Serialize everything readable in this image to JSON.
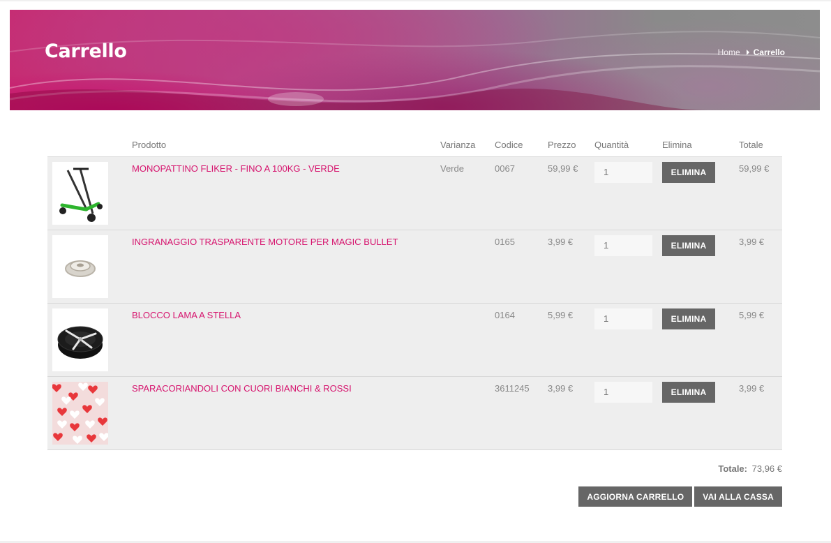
{
  "page": {
    "title": "Carrello"
  },
  "breadcrumb": {
    "home": "Home",
    "current": "Carrello"
  },
  "table": {
    "headers": {
      "product": "Prodotto",
      "variant": "Varianza",
      "code": "Codice",
      "price": "Prezzo",
      "qty": "Quantità",
      "delete": "Elimina",
      "total": "Totale"
    },
    "rows": [
      {
        "name": "MONOPATTINO FLIKER - FINO A 100KG - VERDE",
        "variant": "Verde",
        "code": "0067",
        "price": "59,99 €",
        "qty": "1",
        "delete": "ELIMINA",
        "total": "59,99 €",
        "image": "scooter-image"
      },
      {
        "name": "INGRANAGGIO TRASPARENTE MOTORE PER MAGIC BULLET",
        "variant": "",
        "code": "0165",
        "price": "3,99 €",
        "qty": "1",
        "delete": "ELIMINA",
        "total": "3,99 €",
        "image": "gear-image"
      },
      {
        "name": "BLOCCO LAMA A STELLA",
        "variant": "",
        "code": "0164",
        "price": "5,99 €",
        "qty": "1",
        "delete": "ELIMINA",
        "total": "5,99 €",
        "image": "blade-image"
      },
      {
        "name": "SPARACORIANDOLI CON CUORI BIANCHI & ROSSI",
        "variant": "",
        "code": "3611245",
        "price": "3,99 €",
        "qty": "1",
        "delete": "ELIMINA",
        "total": "3,99 €",
        "image": "hearts-confetti-image"
      }
    ]
  },
  "summary": {
    "label": "Totale:",
    "value": "73,96 €"
  },
  "actions": {
    "update": "AGGIORNA CARRELLO",
    "checkout": "VAI ALLA CASSA"
  },
  "colors": {
    "accent": "#d6146e",
    "button": "#666666",
    "row_bg": "#eeeeee"
  }
}
